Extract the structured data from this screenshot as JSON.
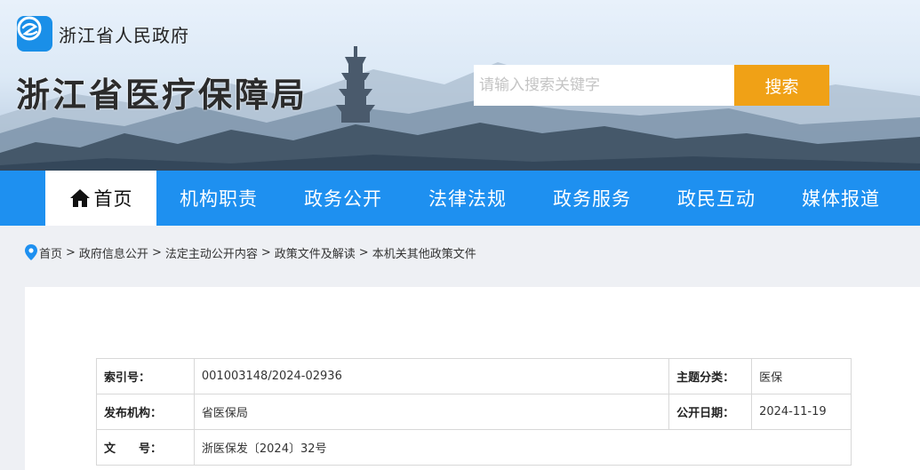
{
  "header": {
    "gov_name": "浙江省人民政府",
    "site_title": "浙江省医疗保障局",
    "search": {
      "placeholder": "请输入搜索关键字",
      "button_label": "搜索"
    }
  },
  "nav": {
    "items": [
      {
        "label": "首页",
        "active": true
      },
      {
        "label": "机构职责"
      },
      {
        "label": "政务公开"
      },
      {
        "label": "法律法规"
      },
      {
        "label": "政务服务"
      },
      {
        "label": "政民互动"
      },
      {
        "label": "媒体报道"
      }
    ]
  },
  "breadcrumb": {
    "items": [
      "首页",
      "政府信息公开",
      "法定主动公开内容",
      "政策文件及解读",
      "本机关其他政策文件"
    ],
    "separator": ">"
  },
  "meta": {
    "index_label": "索引号：",
    "index_value": "001003148/2024-02936",
    "topic_label": "主题分类：",
    "topic_value": "医保",
    "issuer_label": "发布机构：",
    "issuer_value": "省医保局",
    "date_label": "公开日期：",
    "date_value": "2024-11-19",
    "docno_label": "文　　号：",
    "docno_value": "浙医保发〔2024〕32号"
  },
  "colors": {
    "nav_bg": "#1e90f0",
    "search_button": "#f0a116",
    "logo_bg": "#1a8fe8"
  }
}
